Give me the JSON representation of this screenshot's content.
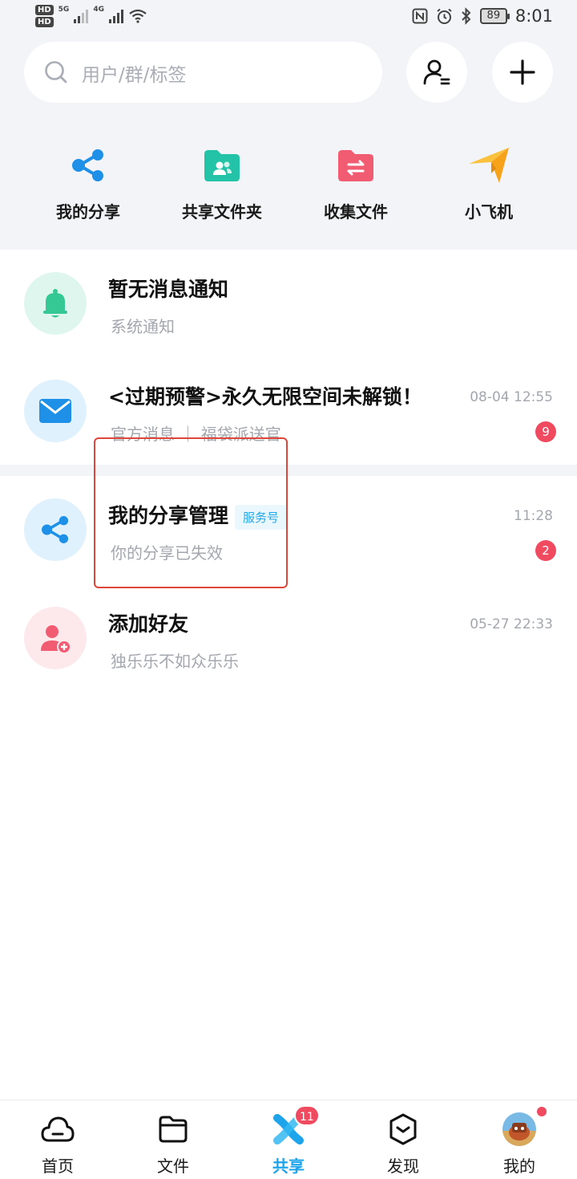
{
  "status_bar": {
    "hd1": "HD",
    "hd2": "HD",
    "net1": "5G",
    "net2": "4G",
    "battery": "89",
    "time": "8:01"
  },
  "search": {
    "placeholder": "用户/群/标签"
  },
  "quick_actions": [
    {
      "label": "我的分享",
      "icon": "share-icon",
      "color": "#1e90e8"
    },
    {
      "label": "共享文件夹",
      "icon": "shared-folder-icon",
      "color": "#22c3a6"
    },
    {
      "label": "收集文件",
      "icon": "collect-folder-icon",
      "color": "#f25c73"
    },
    {
      "label": "小飞机",
      "icon": "paper-plane-icon",
      "color": "#f7b731"
    }
  ],
  "messages": [
    {
      "title": "暂无消息通知",
      "subtitle": "系统通知",
      "time": "",
      "badge": "",
      "icon": "bell-icon"
    },
    {
      "title": "<过期预警>永久无限空间未解锁！",
      "subtitle": "官方消息 ｜ 福袋派送官",
      "time": "08-04 12:55",
      "badge": "9",
      "icon": "mail-icon"
    },
    {
      "title": "我的分享管理",
      "tag": "服务号",
      "subtitle": "你的分享已失效",
      "time": "11:28",
      "badge": "2",
      "icon": "share-icon"
    },
    {
      "title": "添加好友",
      "subtitle": "独乐乐不如众乐乐",
      "time": "05-27 22:33",
      "badge": "",
      "icon": "add-friend-icon"
    }
  ],
  "bottom_nav": [
    {
      "label": "首页",
      "icon": "cloud-icon"
    },
    {
      "label": "文件",
      "icon": "folder-icon"
    },
    {
      "label": "共享",
      "icon": "share-app-icon",
      "badge": "11",
      "active": true
    },
    {
      "label": "发现",
      "icon": "discover-icon"
    },
    {
      "label": "我的",
      "icon": "profile-avatar"
    }
  ],
  "colors": {
    "accent": "#1ea4ea",
    "badge": "#f04a61",
    "highlight": "#e0453a"
  }
}
